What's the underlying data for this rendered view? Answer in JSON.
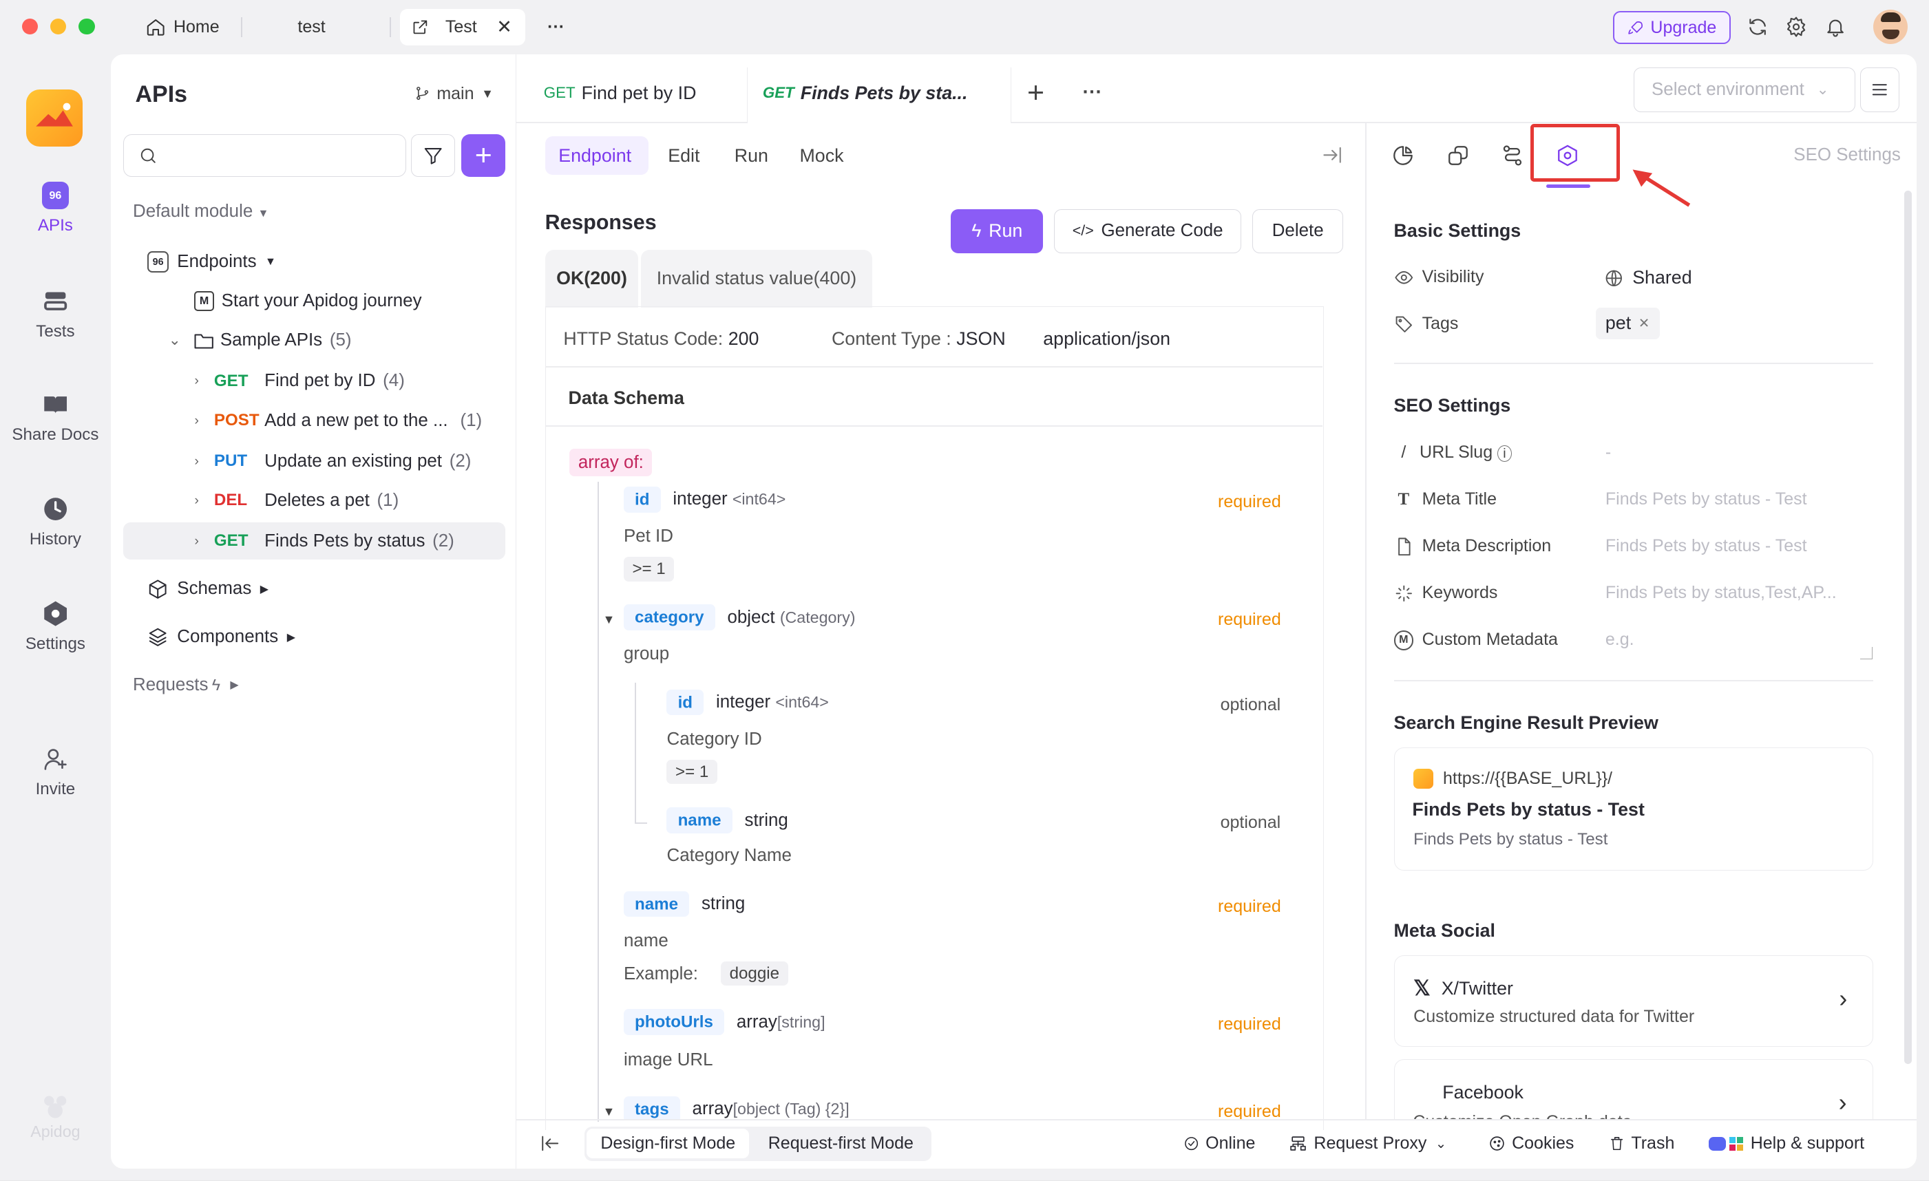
{
  "titlebar": {
    "home": "Home",
    "tab_test_plain": "test",
    "tab_active": "Test",
    "more": "···",
    "upgrade": "Upgrade"
  },
  "rail": [
    {
      "label": "APIs",
      "icon": "apis-icon"
    },
    {
      "label": "Tests",
      "icon": "tests-icon"
    },
    {
      "label": "Share Docs",
      "icon": "book-icon"
    },
    {
      "label": "History",
      "icon": "clock-icon"
    },
    {
      "label": "Settings",
      "icon": "settings-icon"
    },
    {
      "label": "Invite",
      "icon": "invite-icon"
    }
  ],
  "rail_brand": "Apidog",
  "tree": {
    "title": "APIs",
    "branch": "main",
    "default_module": "Default module",
    "endpoints": "Endpoints",
    "journey": "Start your Apidog journey",
    "sample_folder": "Sample APIs",
    "sample_count": "(5)",
    "items": [
      {
        "method": "GET",
        "name": "Find pet by ID",
        "count": "(4)"
      },
      {
        "method": "POST",
        "name": "Add a new pet to the ...",
        "count": "(1)"
      },
      {
        "method": "PUT",
        "name": "Update an existing pet",
        "count": "(2)"
      },
      {
        "method": "DEL",
        "name": "Deletes a pet",
        "count": "(1)"
      },
      {
        "method": "GET",
        "name": "Finds Pets by status",
        "count": "(2)"
      }
    ],
    "schemas": "Schemas",
    "components": "Components",
    "requests": "Requests"
  },
  "doc_tabs": [
    {
      "method": "GET",
      "title": "Find pet by ID"
    },
    {
      "method": "GET",
      "title": "Finds Pets by sta..."
    }
  ],
  "env_placeholder": "Select environment",
  "subtabs": [
    "Endpoint",
    "Edit",
    "Run",
    "Mock"
  ],
  "responses": {
    "title": "Responses",
    "run": "Run",
    "gen_code": "Generate Code",
    "delete": "Delete",
    "tab_ok": "OK(200)",
    "tab_invalid": "Invalid status value(400)",
    "status_label": "HTTP Status Code:",
    "status_value": "200",
    "ctype_label": "Content Type :",
    "ctype_value": "JSON",
    "mime": "application/json",
    "data_schema": "Data Schema",
    "array_of": "array of:"
  },
  "schema": {
    "id": {
      "name": "id",
      "type": "integer",
      "fmt": "<int64>",
      "req": "required",
      "desc": "Pet ID",
      "rule": ">= 1"
    },
    "category": {
      "name": "category",
      "type": "object",
      "fmt": "(Category)",
      "req": "required",
      "desc": "group"
    },
    "cat_id": {
      "name": "id",
      "type": "integer",
      "fmt": "<int64>",
      "req": "optional",
      "desc": "Category ID",
      "rule": ">= 1"
    },
    "cat_name": {
      "name": "name",
      "type": "string",
      "req": "optional",
      "desc": "Category Name"
    },
    "name": {
      "name": "name",
      "type": "string",
      "req": "required",
      "desc": "name",
      "example_label": "Example:",
      "example": "doggie"
    },
    "photoUrls": {
      "name": "photoUrls",
      "type": "array",
      "fmt": "[string]",
      "req": "required",
      "desc": "image URL"
    },
    "tags": {
      "name": "tags",
      "type": "array",
      "fmt": "[object (Tag) {2}]",
      "req": "required"
    }
  },
  "right": {
    "seo_header": "SEO Settings",
    "basic": "Basic Settings",
    "visibility": "Visibility",
    "visibility_value": "Shared",
    "tags": "Tags",
    "tag_value": "pet",
    "seo": "SEO Settings",
    "url_slug": "URL Slug",
    "url_slug_value": "-",
    "meta_title": "Meta Title",
    "meta_title_ph": "Finds Pets by status - Test",
    "meta_desc": "Meta Description",
    "meta_desc_ph": "Finds Pets by status - Test",
    "keywords": "Keywords",
    "keywords_ph": "Finds Pets by status,Test,AP...",
    "custom_meta": "Custom Metadata",
    "custom_meta_ph": "e.g.",
    "preview_title": "Search Engine Result Preview",
    "preview_url": "https://{{BASE_URL}}/",
    "preview_heading": "Finds Pets by status - Test",
    "preview_desc": "Finds Pets by status - Test",
    "meta_social": "Meta Social",
    "twitter": "X/Twitter",
    "twitter_desc": "Customize structured data for Twitter",
    "facebook": "Facebook",
    "facebook_desc": "Customize Open Graph data"
  },
  "bottom": {
    "design_mode": "Design-first Mode",
    "request_mode": "Request-first Mode",
    "online": "Online",
    "proxy": "Request Proxy",
    "cookies": "Cookies",
    "trash": "Trash",
    "help": "Help & support"
  },
  "colors": {
    "accent": "#8b5cf6",
    "get": "#18a058",
    "post": "#e8590c",
    "put": "#1c7ed6",
    "del": "#e03131",
    "required": "#f08c00",
    "highlight": "#e53935"
  }
}
